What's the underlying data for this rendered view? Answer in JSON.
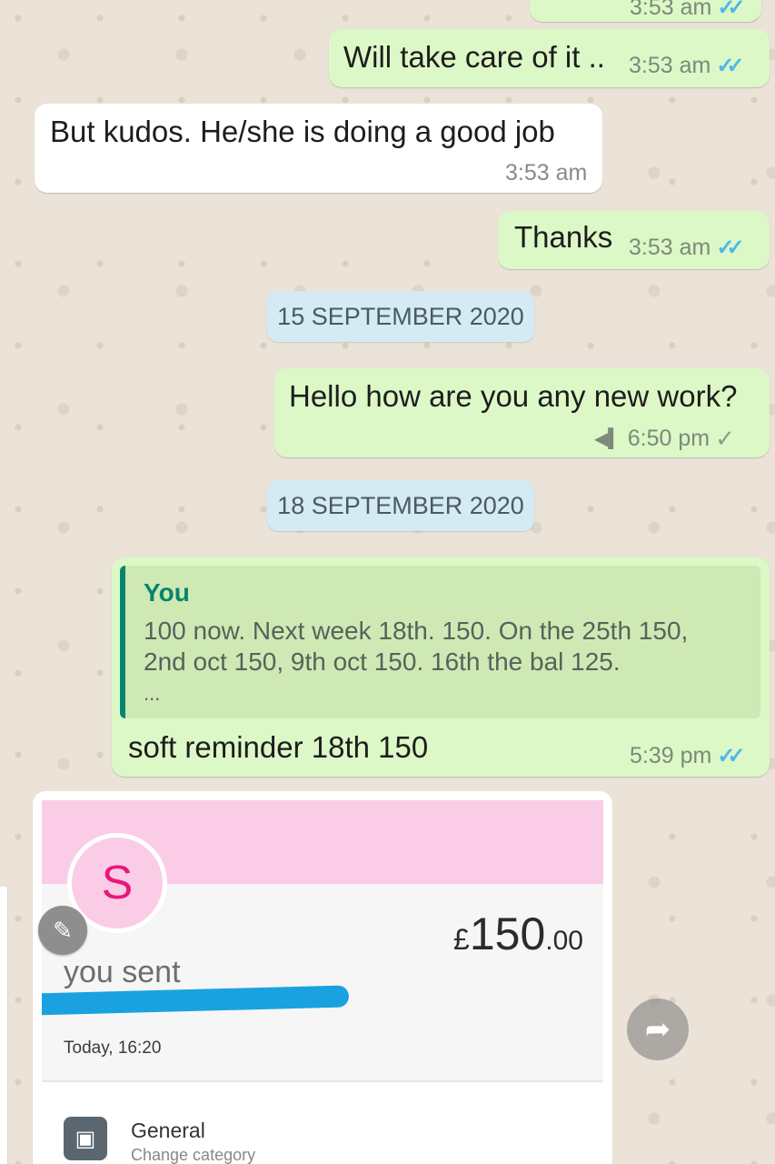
{
  "colors": {
    "outgoing_bubble": "#dcf8c6",
    "incoming_bubble": "#ffffff",
    "read_ticks": "#4fb6ec",
    "date_chip": "#d4eaf4",
    "quote_accent": "#06856c",
    "card_banner": "#fbcce6",
    "avatar_letter": "#e6197a"
  },
  "messages": [
    {
      "text": "",
      "time": "3:53 am",
      "status": "read"
    },
    {
      "text": "Will take care of it ..",
      "time": "3:53 am",
      "status": "read"
    },
    {
      "text": "But kudos. He/she  is doing a good job",
      "time": "3:53 am"
    },
    {
      "text": "Thanks",
      "time": "3:53 am",
      "status": "read"
    },
    {
      "text": "Hello how are you any new work?",
      "time": "6:50 pm",
      "status": "sent",
      "icon": "broadcast-icon"
    },
    {
      "text": "soft reminder 18th 150",
      "time": "5:39 pm",
      "status": "read"
    }
  ],
  "date_separators": [
    "15 SEPTEMBER 2020",
    "18 SEPTEMBER 2020"
  ],
  "quoted": {
    "author": "You",
    "lines": [
      "100 now. Next week 18th. 150.  On the 25th 150,",
      "2nd oct 150, 9th oct 150. 16th the bal 125.",
      "..."
    ]
  },
  "payment_card": {
    "avatar_letter": "S",
    "currency": "£",
    "amount_main": "150",
    "amount_decimals": ".00",
    "sent_label": "you sent",
    "date": "Today, 16:20",
    "category_title": "General",
    "category_sub": "Change category"
  },
  "icons": {
    "read_ticks": "✓✓",
    "sent_tick": "✓",
    "broadcast": "◀▍",
    "edit": "✎",
    "forward": "➦",
    "category": "▣"
  }
}
